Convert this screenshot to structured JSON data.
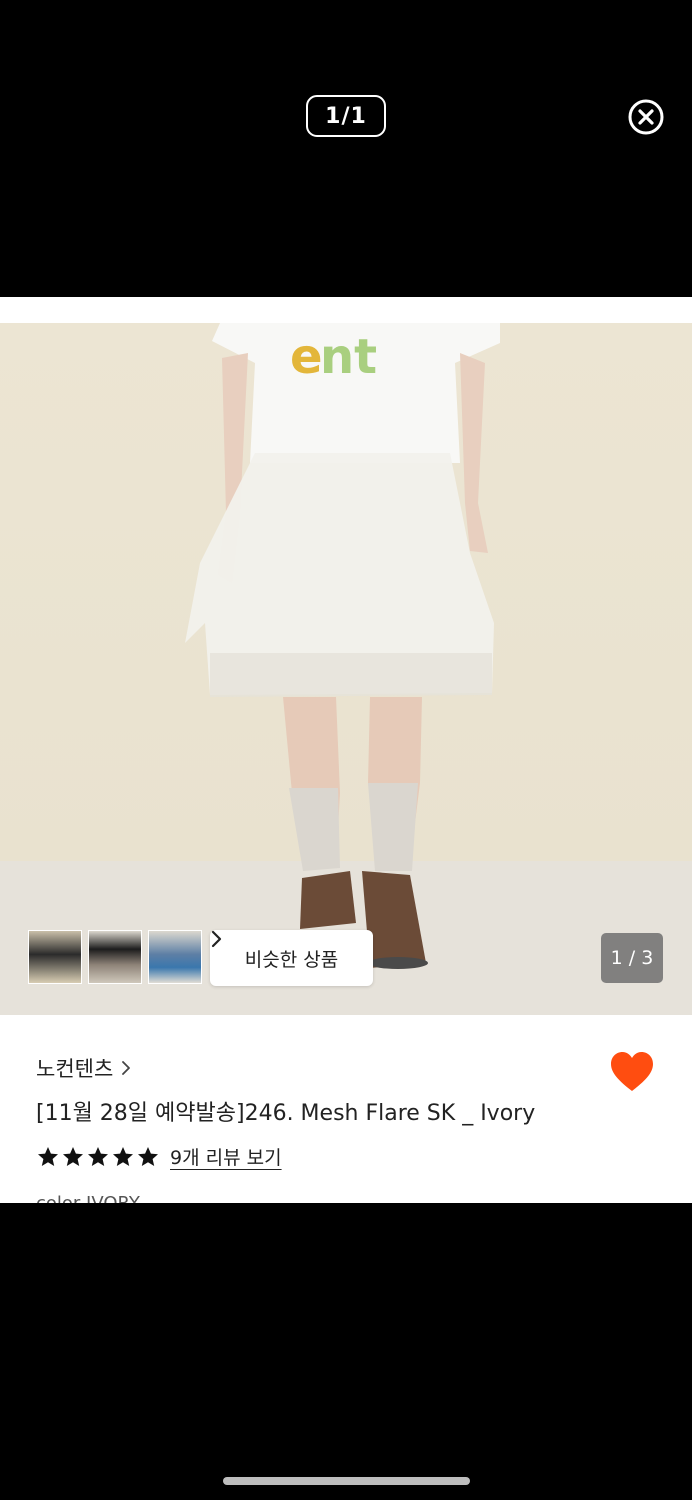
{
  "viewer": {
    "page_indicator": "1/1",
    "close_icon": "close-circle-icon"
  },
  "product": {
    "thumbnails": [
      {
        "name": "thumbnail-1"
      },
      {
        "name": "thumbnail-2"
      },
      {
        "name": "thumbnail-3"
      }
    ],
    "similar_label": "비슷한 상품",
    "image_counter": "1 / 3",
    "brand": "노컨텐츠",
    "title": "[11월 28일 예약발송]246. Mesh Flare SK _ Ivory",
    "rating_stars": 5,
    "review_link": "9개 리뷰 보기",
    "option_cutoff": "color IVORY",
    "heart_color": "#ff4d10"
  }
}
